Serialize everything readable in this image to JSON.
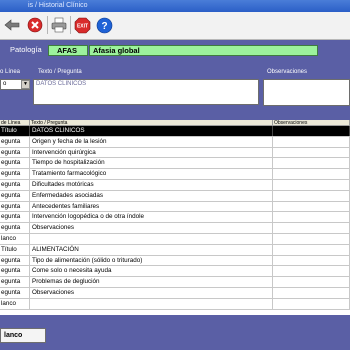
{
  "window": {
    "title": "is / Historial Clínico"
  },
  "patologia": {
    "label": "Patología",
    "code": "AFAS",
    "name": "Afasia global"
  },
  "form": {
    "tipo_label": "o Línea",
    "tipo_value": "o",
    "texto_label": "Texto / Pregunta",
    "texto_value": "DATOS CLINICOS",
    "obs_label": "Observaciones"
  },
  "grid": {
    "headers": [
      "de Línea",
      "Texto / Pregunta",
      "Observaciones"
    ],
    "rows": [
      {
        "tipo": "Título",
        "texto": "DATOS CLINICOS",
        "obs": "",
        "selected": true
      },
      {
        "tipo": "egunta",
        "texto": "Origen y fecha de la lesión",
        "obs": ""
      },
      {
        "tipo": "egunta",
        "texto": "Intervención quirúrgica",
        "obs": ""
      },
      {
        "tipo": "egunta",
        "texto": "Tiempo de hospitalización",
        "obs": ""
      },
      {
        "tipo": "egunta",
        "texto": "Tratamiento farmacológico",
        "obs": ""
      },
      {
        "tipo": "egunta",
        "texto": "Dificultades motóricas",
        "obs": ""
      },
      {
        "tipo": "egunta",
        "texto": "Enfermedades asociadas",
        "obs": ""
      },
      {
        "tipo": "egunta",
        "texto": "Antecedentes familiares",
        "obs": ""
      },
      {
        "tipo": "egunta",
        "texto": "Intervención logopédica o de otra índole",
        "obs": ""
      },
      {
        "tipo": "egunta",
        "texto": "Observaciones",
        "obs": ""
      },
      {
        "tipo": "lanco",
        "texto": "",
        "obs": ""
      },
      {
        "tipo": "Título",
        "texto": "ALIMENTACIÓN",
        "obs": ""
      },
      {
        "tipo": "egunta",
        "texto": "Tipo de alimentación (sólido o triturado)",
        "obs": ""
      },
      {
        "tipo": "egunta",
        "texto": "Come solo o necesita ayuda",
        "obs": ""
      },
      {
        "tipo": "egunta",
        "texto": "Problemas de deglución",
        "obs": ""
      },
      {
        "tipo": "egunta",
        "texto": "Observaciones",
        "obs": ""
      },
      {
        "tipo": "lanco",
        "texto": "",
        "obs": ""
      }
    ]
  },
  "buttons": {
    "clear_label": "lanco"
  },
  "toolbar": {
    "icons": [
      "back-arrow-icon",
      "delete-icon",
      "print-icon",
      "exit-icon",
      "help-icon"
    ],
    "exit_text": "EXIT",
    "help_text": "?"
  },
  "colors": {
    "panel": "#5a5fa5",
    "highlight_green": "#9cf29c",
    "selected_row": "#000000",
    "delete_red": "#d92b2b",
    "help_blue": "#1f62d6"
  }
}
